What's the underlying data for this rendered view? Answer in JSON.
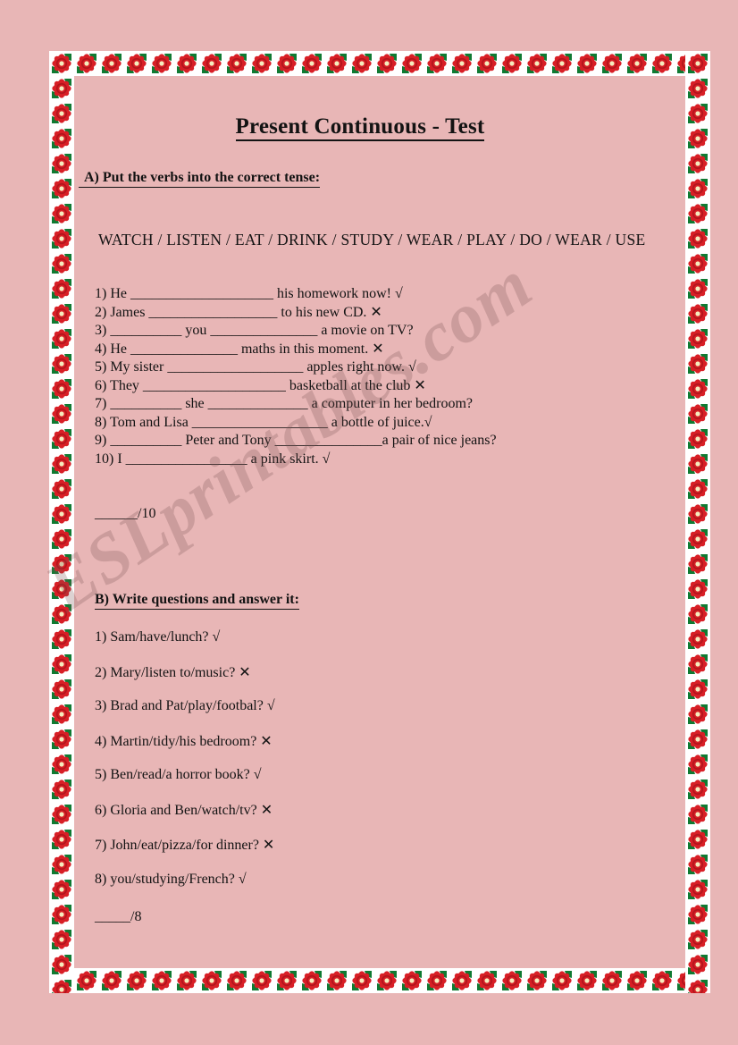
{
  "document": {
    "title": "Present Continuous - Test",
    "background_color": "#e8b6b6",
    "text_color": "#131313"
  },
  "watermark": {
    "text": "ESLprintables.com"
  },
  "border": {
    "motif": "red-rose-flower-tile",
    "tile_background": "#ffffff",
    "flower_color": "#d81f26",
    "flower_center_color": "#f5edbe",
    "leaf_color": "#0f7a32"
  },
  "section_a": {
    "heading": "A) Put the verbs into the correct tense:",
    "verb_bank": "WATCH / LISTEN / EAT / DRINK / STUDY / WEAR / PLAY / DO / WEAR / USE",
    "items": [
      "1)  He ____________________ his homework now! √",
      "2) James __________________ to his new CD. ✕",
      "3) __________ you _______________ a movie on TV?",
      "4) He _______________ maths in this moment. ✕",
      "5) My sister ___________________ apples right now. √",
      "6) They ____________________ basketball at the club ✕",
      "7) __________ she ______________ a computer in her bedroom?",
      "8) Tom and Lisa ___________________ a bottle of juice.√",
      "9) __________ Peter and Tony _______________a pair of nice jeans?",
      "10) I _________________ a pink skirt. √"
    ],
    "score": "______/10"
  },
  "section_b": {
    "heading": "B) Write questions and answer it:",
    "items": [
      "1) Sam/have/lunch? √",
      "2) Mary/listen to/music? ✕",
      "3) Brad and Pat/play/footbal? √",
      "4) Martin/tidy/his bedroom? ✕",
      "5) Ben/read/a horror book? √",
      "6) Gloria and Ben/watch/tv? ✕",
      "7) John/eat/pizza/for dinner? ✕",
      "8) you/studying/French? √"
    ],
    "score": "_____/8"
  }
}
